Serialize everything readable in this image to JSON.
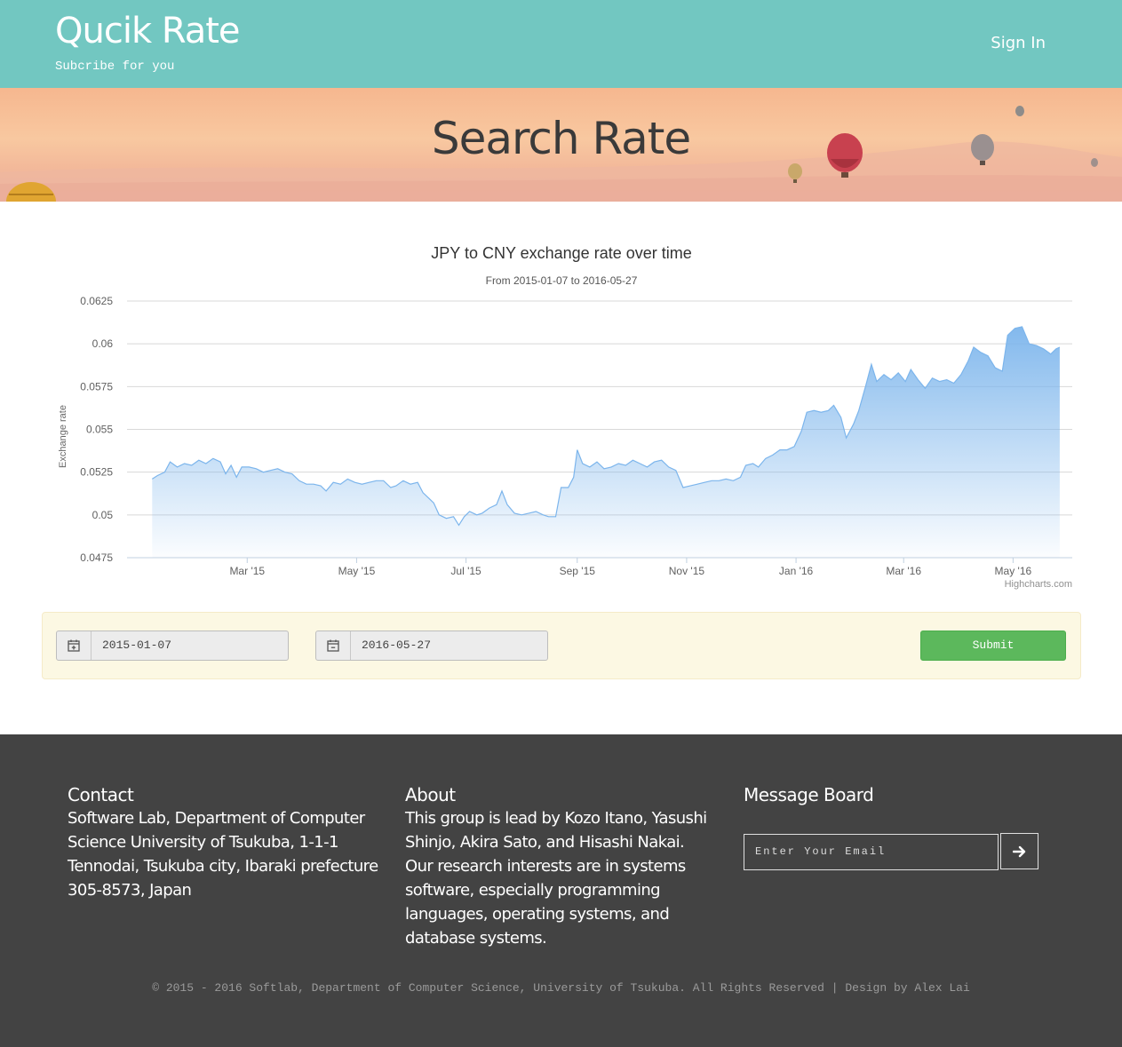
{
  "header": {
    "brand": "Qucik Rate",
    "tagline": "Subcribe for you",
    "signin_label": "Sign In"
  },
  "banner": {
    "title": "Search Rate"
  },
  "chart_data": {
    "type": "area",
    "title": "JPY to CNY exchange rate over time",
    "subtitle": "From 2015-01-07 to 2016-05-27",
    "ylabel": "Exchange rate",
    "xlabel": "",
    "ylim": [
      0.0475,
      0.0625
    ],
    "yticks": [
      0.0475,
      0.05,
      0.0525,
      0.055,
      0.0575,
      0.06,
      0.0625
    ],
    "ytick_labels": [
      "0.0475",
      "0.05",
      "0.0525",
      "0.055",
      "0.0575",
      "0.06",
      "0.0625"
    ],
    "xlim": [
      "2015-01-07",
      "2016-05-27"
    ],
    "xticks": [
      "2015-03-01",
      "2015-05-01",
      "2015-07-01",
      "2015-09-01",
      "2015-11-01",
      "2016-01-01",
      "2016-03-01",
      "2016-05-01"
    ],
    "xtick_labels": [
      "Mar '15",
      "May '15",
      "Jul '15",
      "Sep '15",
      "Nov '15",
      "Jan '16",
      "Mar '16",
      "May '16"
    ],
    "grid": true,
    "legend": "none",
    "credits": "Highcharts.com",
    "color": "#7cb5ec",
    "series": [
      {
        "points": [
          [
            "2015-01-07",
            0.0521
          ],
          [
            "2015-01-10",
            0.0523
          ],
          [
            "2015-01-14",
            0.0525
          ],
          [
            "2015-01-17",
            0.0531
          ],
          [
            "2015-01-21",
            0.0528
          ],
          [
            "2015-01-25",
            0.053
          ],
          [
            "2015-01-29",
            0.0529
          ],
          [
            "2015-02-02",
            0.0532
          ],
          [
            "2015-02-06",
            0.053
          ],
          [
            "2015-02-10",
            0.0533
          ],
          [
            "2015-02-14",
            0.0531
          ],
          [
            "2015-02-17",
            0.0524
          ],
          [
            "2015-02-20",
            0.0529
          ],
          [
            "2015-02-23",
            0.0522
          ],
          [
            "2015-02-26",
            0.0528
          ],
          [
            "2015-03-02",
            0.0528
          ],
          [
            "2015-03-06",
            0.0527
          ],
          [
            "2015-03-10",
            0.0525
          ],
          [
            "2015-03-14",
            0.0526
          ],
          [
            "2015-03-18",
            0.0527
          ],
          [
            "2015-03-22",
            0.0525
          ],
          [
            "2015-03-26",
            0.0524
          ],
          [
            "2015-03-30",
            0.052
          ],
          [
            "2015-04-03",
            0.0518
          ],
          [
            "2015-04-07",
            0.0518
          ],
          [
            "2015-04-11",
            0.0517
          ],
          [
            "2015-04-14",
            0.0514
          ],
          [
            "2015-04-18",
            0.0519
          ],
          [
            "2015-04-22",
            0.0518
          ],
          [
            "2015-04-26",
            0.0521
          ],
          [
            "2015-04-30",
            0.0519
          ],
          [
            "2015-05-04",
            0.0518
          ],
          [
            "2015-05-08",
            0.0519
          ],
          [
            "2015-05-12",
            0.052
          ],
          [
            "2015-05-16",
            0.052
          ],
          [
            "2015-05-20",
            0.0516
          ],
          [
            "2015-05-23",
            0.0517
          ],
          [
            "2015-05-27",
            0.052
          ],
          [
            "2015-05-31",
            0.0518
          ],
          [
            "2015-06-04",
            0.0519
          ],
          [
            "2015-06-07",
            0.0513
          ],
          [
            "2015-06-10",
            0.051
          ],
          [
            "2015-06-13",
            0.0507
          ],
          [
            "2015-06-16",
            0.05
          ],
          [
            "2015-06-20",
            0.0498
          ],
          [
            "2015-06-24",
            0.0499
          ],
          [
            "2015-06-27",
            0.0494
          ],
          [
            "2015-06-30",
            0.0499
          ],
          [
            "2015-07-03",
            0.0502
          ],
          [
            "2015-07-07",
            0.05
          ],
          [
            "2015-07-10",
            0.0501
          ],
          [
            "2015-07-14",
            0.0504
          ],
          [
            "2015-07-18",
            0.0506
          ],
          [
            "2015-07-21",
            0.0514
          ],
          [
            "2015-07-24",
            0.0506
          ],
          [
            "2015-07-28",
            0.0501
          ],
          [
            "2015-08-01",
            0.05
          ],
          [
            "2015-08-05",
            0.0501
          ],
          [
            "2015-08-09",
            0.0502
          ],
          [
            "2015-08-13",
            0.05
          ],
          [
            "2015-08-16",
            0.0499
          ],
          [
            "2015-08-20",
            0.0499
          ],
          [
            "2015-08-23",
            0.0516
          ],
          [
            "2015-08-27",
            0.0516
          ],
          [
            "2015-08-30",
            0.0522
          ],
          [
            "2015-09-01",
            0.0538
          ],
          [
            "2015-09-04",
            0.053
          ],
          [
            "2015-09-08",
            0.0528
          ],
          [
            "2015-09-12",
            0.0531
          ],
          [
            "2015-09-16",
            0.0527
          ],
          [
            "2015-09-20",
            0.0528
          ],
          [
            "2015-09-24",
            0.053
          ],
          [
            "2015-09-28",
            0.0529
          ],
          [
            "2015-10-02",
            0.0532
          ],
          [
            "2015-10-06",
            0.053
          ],
          [
            "2015-10-10",
            0.0528
          ],
          [
            "2015-10-14",
            0.0531
          ],
          [
            "2015-10-18",
            0.0532
          ],
          [
            "2015-10-22",
            0.0528
          ],
          [
            "2015-10-26",
            0.0526
          ],
          [
            "2015-10-30",
            0.0516
          ],
          [
            "2015-11-03",
            0.0517
          ],
          [
            "2015-11-07",
            0.0518
          ],
          [
            "2015-11-11",
            0.0519
          ],
          [
            "2015-11-15",
            0.052
          ],
          [
            "2015-11-19",
            0.052
          ],
          [
            "2015-11-23",
            0.0521
          ],
          [
            "2015-11-27",
            0.052
          ],
          [
            "2015-12-01",
            0.0522
          ],
          [
            "2015-12-04",
            0.0529
          ],
          [
            "2015-12-08",
            0.053
          ],
          [
            "2015-12-11",
            0.0528
          ],
          [
            "2015-12-15",
            0.0533
          ],
          [
            "2015-12-19",
            0.0535
          ],
          [
            "2015-12-23",
            0.0538
          ],
          [
            "2015-12-27",
            0.0538
          ],
          [
            "2015-12-31",
            0.054
          ],
          [
            "2016-01-04",
            0.0549
          ],
          [
            "2016-01-07",
            0.056
          ],
          [
            "2016-01-11",
            0.0561
          ],
          [
            "2016-01-15",
            0.056
          ],
          [
            "2016-01-19",
            0.0561
          ],
          [
            "2016-01-22",
            0.0564
          ],
          [
            "2016-01-26",
            0.0557
          ],
          [
            "2016-01-29",
            0.0545
          ],
          [
            "2016-02-02",
            0.0553
          ],
          [
            "2016-02-05",
            0.0561
          ],
          [
            "2016-02-09",
            0.0576
          ],
          [
            "2016-02-12",
            0.0588
          ],
          [
            "2016-02-15",
            0.0578
          ],
          [
            "2016-02-19",
            0.0582
          ],
          [
            "2016-02-23",
            0.0579
          ],
          [
            "2016-02-27",
            0.0583
          ],
          [
            "2016-03-02",
            0.0578
          ],
          [
            "2016-03-05",
            0.0585
          ],
          [
            "2016-03-09",
            0.0579
          ],
          [
            "2016-03-13",
            0.0574
          ],
          [
            "2016-03-17",
            0.058
          ],
          [
            "2016-03-21",
            0.0578
          ],
          [
            "2016-03-25",
            0.0579
          ],
          [
            "2016-03-29",
            0.0577
          ],
          [
            "2016-04-02",
            0.0582
          ],
          [
            "2016-04-06",
            0.059
          ],
          [
            "2016-04-09",
            0.0598
          ],
          [
            "2016-04-13",
            0.0595
          ],
          [
            "2016-04-17",
            0.0593
          ],
          [
            "2016-04-21",
            0.0586
          ],
          [
            "2016-04-25",
            0.0584
          ],
          [
            "2016-04-28",
            0.0605
          ],
          [
            "2016-05-02",
            0.0609
          ],
          [
            "2016-05-06",
            0.061
          ],
          [
            "2016-05-10",
            0.06
          ],
          [
            "2016-05-14",
            0.0599
          ],
          [
            "2016-05-18",
            0.0597
          ],
          [
            "2016-05-22",
            0.0594
          ],
          [
            "2016-05-25",
            0.0597
          ],
          [
            "2016-05-27",
            0.0598
          ]
        ]
      }
    ]
  },
  "search": {
    "start_date": "2015-01-07",
    "end_date": "2016-05-27",
    "submit_label": "Submit"
  },
  "footer": {
    "contact": {
      "heading": "Contact",
      "text": "Software Lab, Department of Computer Science University of Tsukuba, 1-1-1 Tennodai, Tsukuba city, Ibaraki prefecture 305-8573, Japan"
    },
    "about": {
      "heading": "About",
      "text": "This group is lead by Kozo Itano, Yasushi Shinjo, Akira Sato, and Hisashi Nakai. Our research interests are in systems software, especially programming languages, operating systems, and database systems."
    },
    "message_board": {
      "heading": "Message Board",
      "email_placeholder": "Enter Your Email"
    },
    "copyright": "© 2015 - 2016 Softlab, Department of Computer Science, University of Tsukuba. All Rights Reserved | Design by Alex Lai"
  },
  "colors": {
    "header_bg": "#72c7c1",
    "footer_bg": "#434343",
    "submit_bg": "#5cb85c",
    "panel_bg": "#fcf8e3"
  },
  "icons": {
    "start_date": "calendar-plus-icon",
    "end_date": "calendar-minus-icon",
    "email_submit": "arrow-right-icon"
  }
}
